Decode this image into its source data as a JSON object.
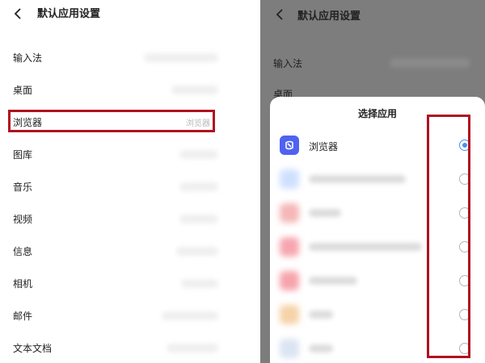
{
  "left": {
    "title": "默认应用设置",
    "rows": [
      {
        "label": "输入法",
        "value": ""
      },
      {
        "label": "桌面",
        "value": ""
      },
      {
        "label": "浏览器",
        "value": "浏览器"
      },
      {
        "label": "图库",
        "value": ""
      },
      {
        "label": "音乐",
        "value": ""
      },
      {
        "label": "视频",
        "value": ""
      },
      {
        "label": "信息",
        "value": ""
      },
      {
        "label": "相机",
        "value": ""
      },
      {
        "label": "邮件",
        "value": ""
      },
      {
        "label": "文本文档",
        "value": ""
      }
    ]
  },
  "right": {
    "title": "默认应用设置",
    "bg_rows": [
      "输入法",
      "桌面"
    ],
    "sheet": {
      "title": "选择应用",
      "apps": [
        {
          "name": "浏览器",
          "selected": true,
          "icon": "browser-icon",
          "color": "#4f62f0"
        },
        {
          "name": "",
          "selected": false,
          "icon": "blurred-app-icon",
          "color": "#cfe0ff"
        },
        {
          "name": "",
          "selected": false,
          "icon": "blurred-app-icon",
          "color": "#f5b7b7"
        },
        {
          "name": "",
          "selected": false,
          "icon": "blurred-app-icon",
          "color": "#f7a6b0"
        },
        {
          "name": "",
          "selected": false,
          "icon": "blurred-app-icon",
          "color": "#f6a4ac"
        },
        {
          "name": "",
          "selected": false,
          "icon": "blurred-app-icon",
          "color": "#f6d3a8"
        },
        {
          "name": "",
          "selected": false,
          "icon": "blurred-app-icon",
          "color": "#dbe4f2"
        }
      ]
    }
  },
  "colors": {
    "highlight": "#b01020",
    "radio_selected": "#4a8ef0",
    "overlay": "#7d7d7d"
  }
}
